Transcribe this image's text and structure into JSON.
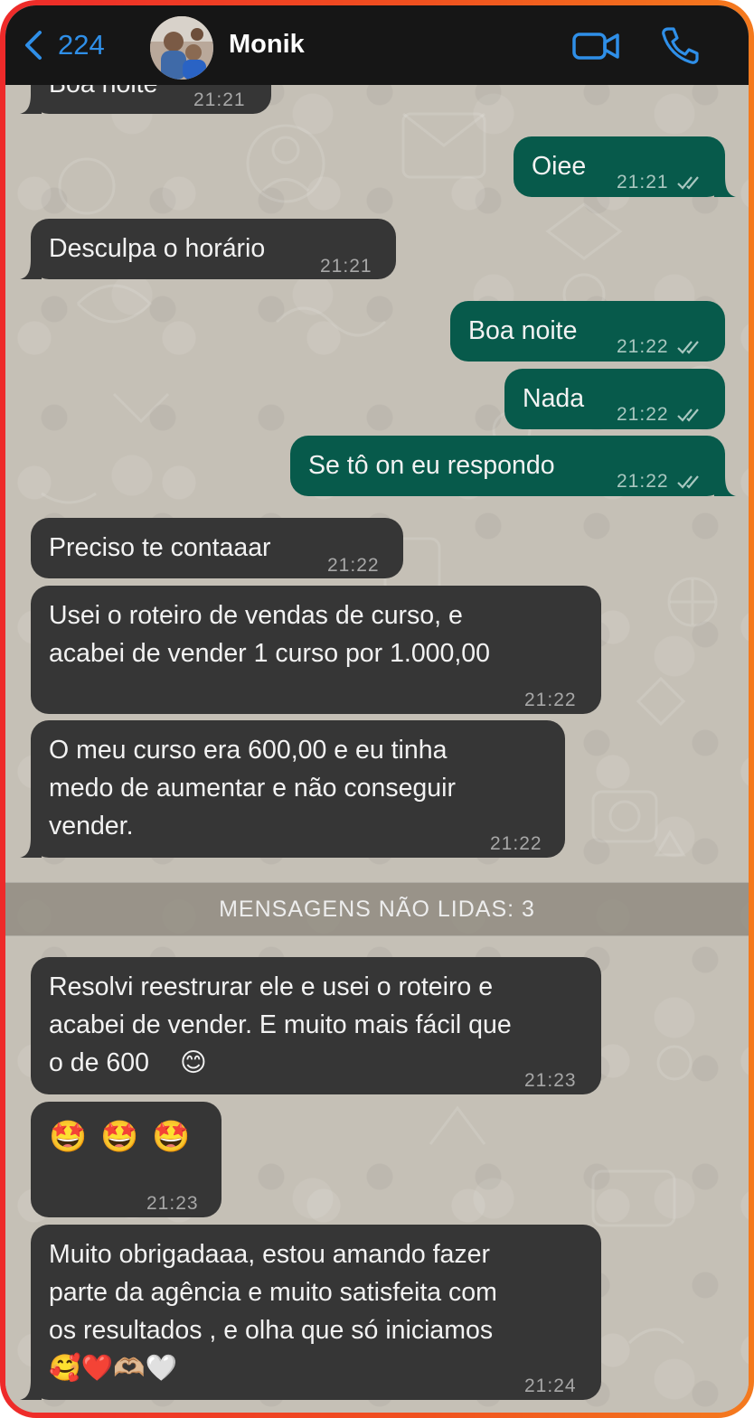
{
  "header": {
    "back_count": "224",
    "contact_name": "Monik"
  },
  "unread_banner": "MENSAGENS NÃO LIDAS: 3",
  "messages": [
    {
      "dir": "in",
      "text": "Boa noite",
      "time": "21:21"
    },
    {
      "dir": "out",
      "text": "Oiee",
      "time": "21:21"
    },
    {
      "dir": "in",
      "text": "Desculpa o horário",
      "time": "21:21"
    },
    {
      "dir": "out",
      "text": "Boa noite",
      "time": "21:22"
    },
    {
      "dir": "out",
      "text": "Nada",
      "time": "21:22"
    },
    {
      "dir": "out",
      "text": "Se tô on eu respondo",
      "time": "21:22"
    },
    {
      "dir": "in",
      "text": "Preciso te contaaar",
      "time": "21:22"
    },
    {
      "dir": "in",
      "lines": [
        "Usei o roteiro de vendas de curso, e",
        "acabei de vender 1 curso por 1.000,00"
      ],
      "time": "21:22"
    },
    {
      "dir": "in",
      "lines": [
        "O meu curso era 600,00 e eu tinha",
        "medo de aumentar e não conseguir",
        "vender."
      ],
      "time": "21:22"
    },
    {
      "dir": "in",
      "lines": [
        "Resolvi reestrurar ele e usei o roteiro e",
        "acabei de vender. E muito mais fácil que",
        "o de 600"
      ],
      "emoji": "😊",
      "time": "21:23"
    },
    {
      "dir": "in",
      "emoji_only": "🤩 🤩 🤩",
      "time": "21:23"
    },
    {
      "dir": "in",
      "lines": [
        "Muito obrigadaaa, estou amando fazer",
        "parte da agência e muito satisfeita com",
        "os resultados , e olha que só iniciamos"
      ],
      "emoji_line": "🥰❤️🫶🏼🤍",
      "time": "21:24"
    }
  ],
  "colors": {
    "incoming_bubble": "#363636",
    "outgoing_bubble": "#075a4b",
    "header_bg": "#161616",
    "accent": "#2f8fe8"
  },
  "icons": [
    "chevron-left-icon",
    "video-camera-icon",
    "phone-icon",
    "double-check-icon"
  ]
}
